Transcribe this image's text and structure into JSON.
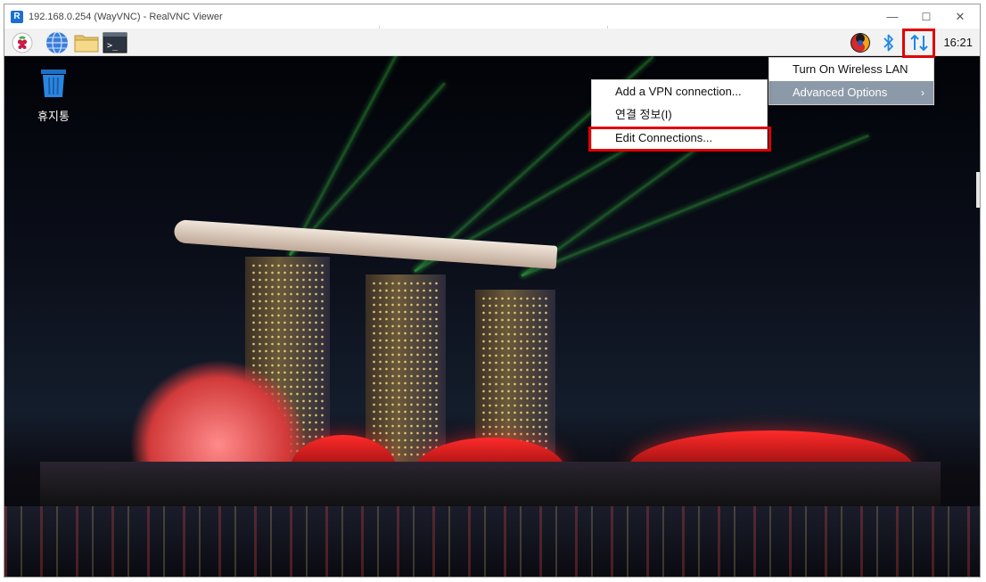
{
  "window": {
    "app_icon": "R",
    "title": "192.168.0.254 (WayVNC) - RealVNC Viewer",
    "controls": {
      "minimize": "—",
      "maximize": "☐",
      "close": "✕"
    }
  },
  "taskbar": {
    "icons": [
      "raspberry-menu-icon",
      "web-browser-icon",
      "file-manager-icon",
      "terminal-icon"
    ],
    "terminal_glyph": ">_",
    "tray": [
      "keyboard-input-icon",
      "bluetooth-icon",
      "network-icon"
    ],
    "clock": "16:21"
  },
  "desktop": {
    "trash_label": "휴지통"
  },
  "network_menu": {
    "items": [
      {
        "label": "Turn On Wireless LAN"
      },
      {
        "label": "Advanced Options",
        "arrow": "›"
      }
    ]
  },
  "submenu": {
    "items": [
      {
        "label": "Add a VPN connection..."
      },
      {
        "label": "연결 정보(I)"
      },
      {
        "label": "Edit Connections..."
      }
    ]
  },
  "colors": {
    "highlight": "#e00000",
    "menu_selected": "#8c99a8",
    "bluetooth": "#1e88e5",
    "network": "#1e88e5"
  }
}
